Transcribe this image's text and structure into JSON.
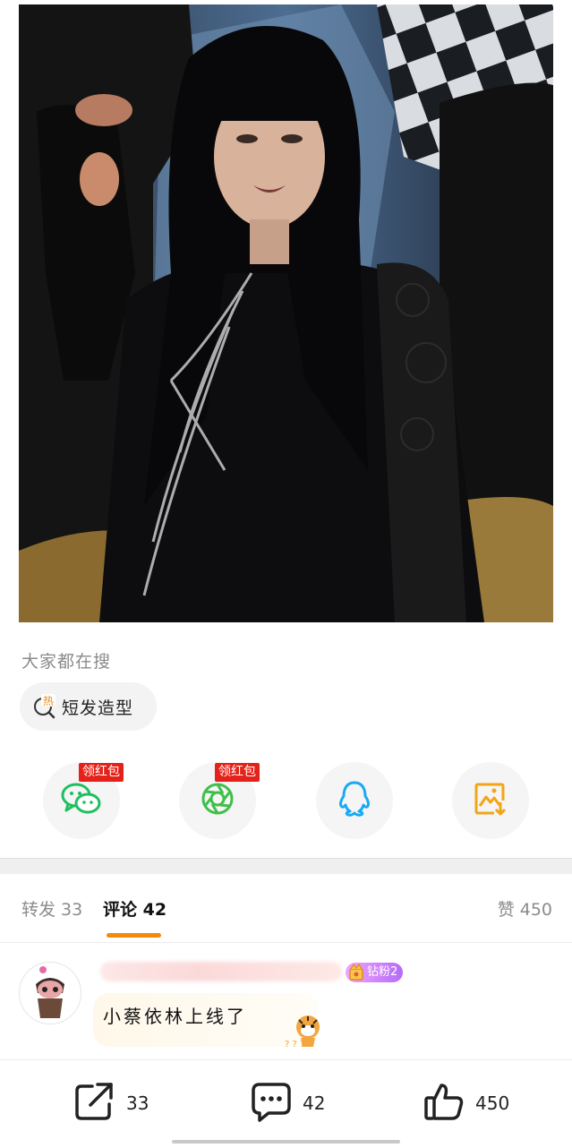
{
  "search": {
    "section_label": "大家都在搜",
    "chip_icon": "hot-search-icon",
    "chip_hot_mark": "热",
    "chip_text": "短发造型"
  },
  "share": {
    "items": [
      {
        "icon": "wechat-icon",
        "badge": "领红包",
        "color": "#1fbf5f"
      },
      {
        "icon": "moments-icon",
        "badge": "领红包",
        "color": "#3fbf4a"
      },
      {
        "icon": "qq-icon",
        "color": "#19a9f2"
      },
      {
        "icon": "save-image-icon",
        "color": "#f2a516"
      }
    ]
  },
  "tabs": {
    "repost": "转发 33",
    "comments": "评论 42",
    "likes": "赞 450",
    "accent": "#f28a0f"
  },
  "comment": {
    "fan_badge": "钻粉2",
    "text": "小蔡依林上线了"
  },
  "bottom_bar": {
    "repost_count": "33",
    "comment_count": "42",
    "like_count": "450"
  }
}
